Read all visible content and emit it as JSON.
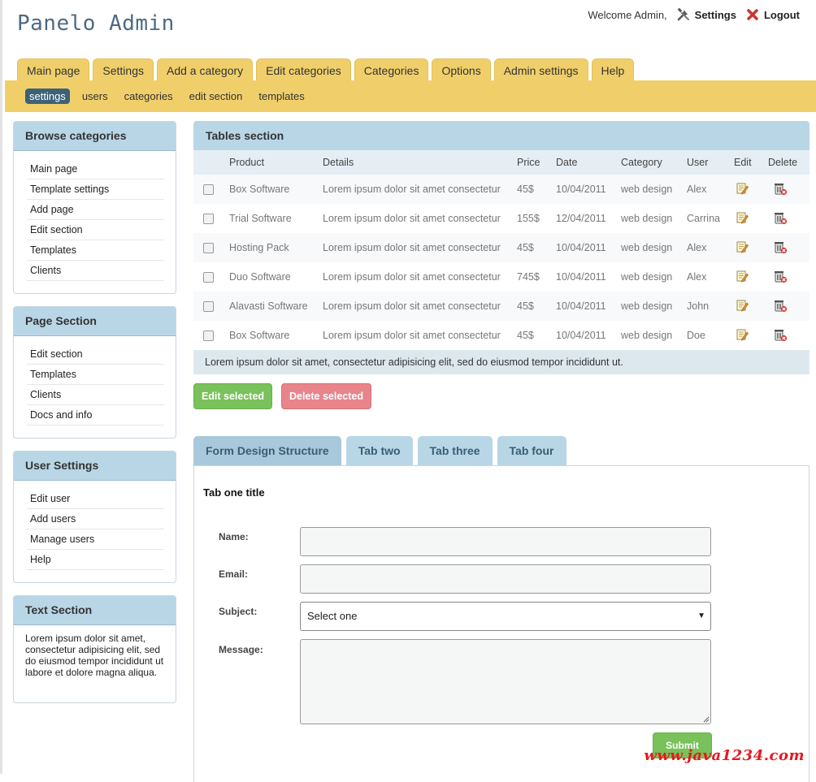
{
  "header": {
    "logo": "Panelo Admin",
    "welcome": "Welcome Admin,",
    "settings_label": "Settings",
    "logout_label": "Logout"
  },
  "main_nav": [
    "Main page",
    "Settings",
    "Add a category",
    "Edit categories",
    "Categories",
    "Options",
    "Admin settings",
    "Help"
  ],
  "sub_nav": [
    "settings",
    "users",
    "categories",
    "edit section",
    "templates"
  ],
  "sidebar": {
    "browse": {
      "title": "Browse categories",
      "items": [
        "Main page",
        "Template settings",
        "Add page",
        "Edit section",
        "Templates",
        "Clients"
      ]
    },
    "page_section": {
      "title": "Page Section",
      "items": [
        "Edit section",
        "Templates",
        "Clients",
        "Docs and info"
      ]
    },
    "user_settings": {
      "title": "User Settings",
      "items": [
        "Edit user",
        "Add users",
        "Manage users",
        "Help"
      ]
    },
    "text_section": {
      "title": "Text Section",
      "text": "Lorem ipsum dolor sit amet, consectetur adipisicing elit, sed do eiusmod tempor incididunt ut labore et dolore magna aliqua."
    }
  },
  "tables": {
    "title": "Tables section",
    "columns": [
      "Product",
      "Details",
      "Price",
      "Date",
      "Category",
      "User",
      "Edit",
      "Delete"
    ],
    "rows": [
      {
        "product": "Box Software",
        "details": "Lorem ipsum dolor sit amet consectetur",
        "price": "45$",
        "date": "10/04/2011",
        "category": "web design",
        "user": "Alex"
      },
      {
        "product": "Trial Software",
        "details": "Lorem ipsum dolor sit amet consectetur",
        "price": "155$",
        "date": "12/04/2011",
        "category": "web design",
        "user": "Carrina"
      },
      {
        "product": "Hosting Pack",
        "details": "Lorem ipsum dolor sit amet consectetur",
        "price": "45$",
        "date": "10/04/2011",
        "category": "web design",
        "user": "Alex"
      },
      {
        "product": "Duo Software",
        "details": "Lorem ipsum dolor sit amet consectetur",
        "price": "745$",
        "date": "10/04/2011",
        "category": "web design",
        "user": "Alex"
      },
      {
        "product": "Alavasti Software",
        "details": "Lorem ipsum dolor sit amet consectetur",
        "price": "45$",
        "date": "10/04/2011",
        "category": "web design",
        "user": "John"
      },
      {
        "product": "Box Software",
        "details": "Lorem ipsum dolor sit amet consectetur",
        "price": "45$",
        "date": "10/04/2011",
        "category": "web design",
        "user": "Doe"
      }
    ],
    "footer": "Lorem ipsum dolor sit amet, consectetur adipisicing elit, sed do eiusmod tempor incididunt ut.",
    "edit_selected": "Edit selected",
    "delete_selected": "Delete selected"
  },
  "form": {
    "tabs": [
      "Form Design Structure",
      "Tab two",
      "Tab three",
      "Tab four"
    ],
    "title": "Tab one title",
    "name_label": "Name:",
    "email_label": "Email:",
    "subject_label": "Subject:",
    "subject_value": "Select one",
    "message_label": "Message:",
    "submit_label": "Submit"
  },
  "watermark": "www.java1234.com",
  "colors": {
    "nav_yellow": "#f0cf6b",
    "panel_blue": "#b8d6e6",
    "green": "#79c15a",
    "red": "#e8848b",
    "active_sub": "#3c6278"
  }
}
